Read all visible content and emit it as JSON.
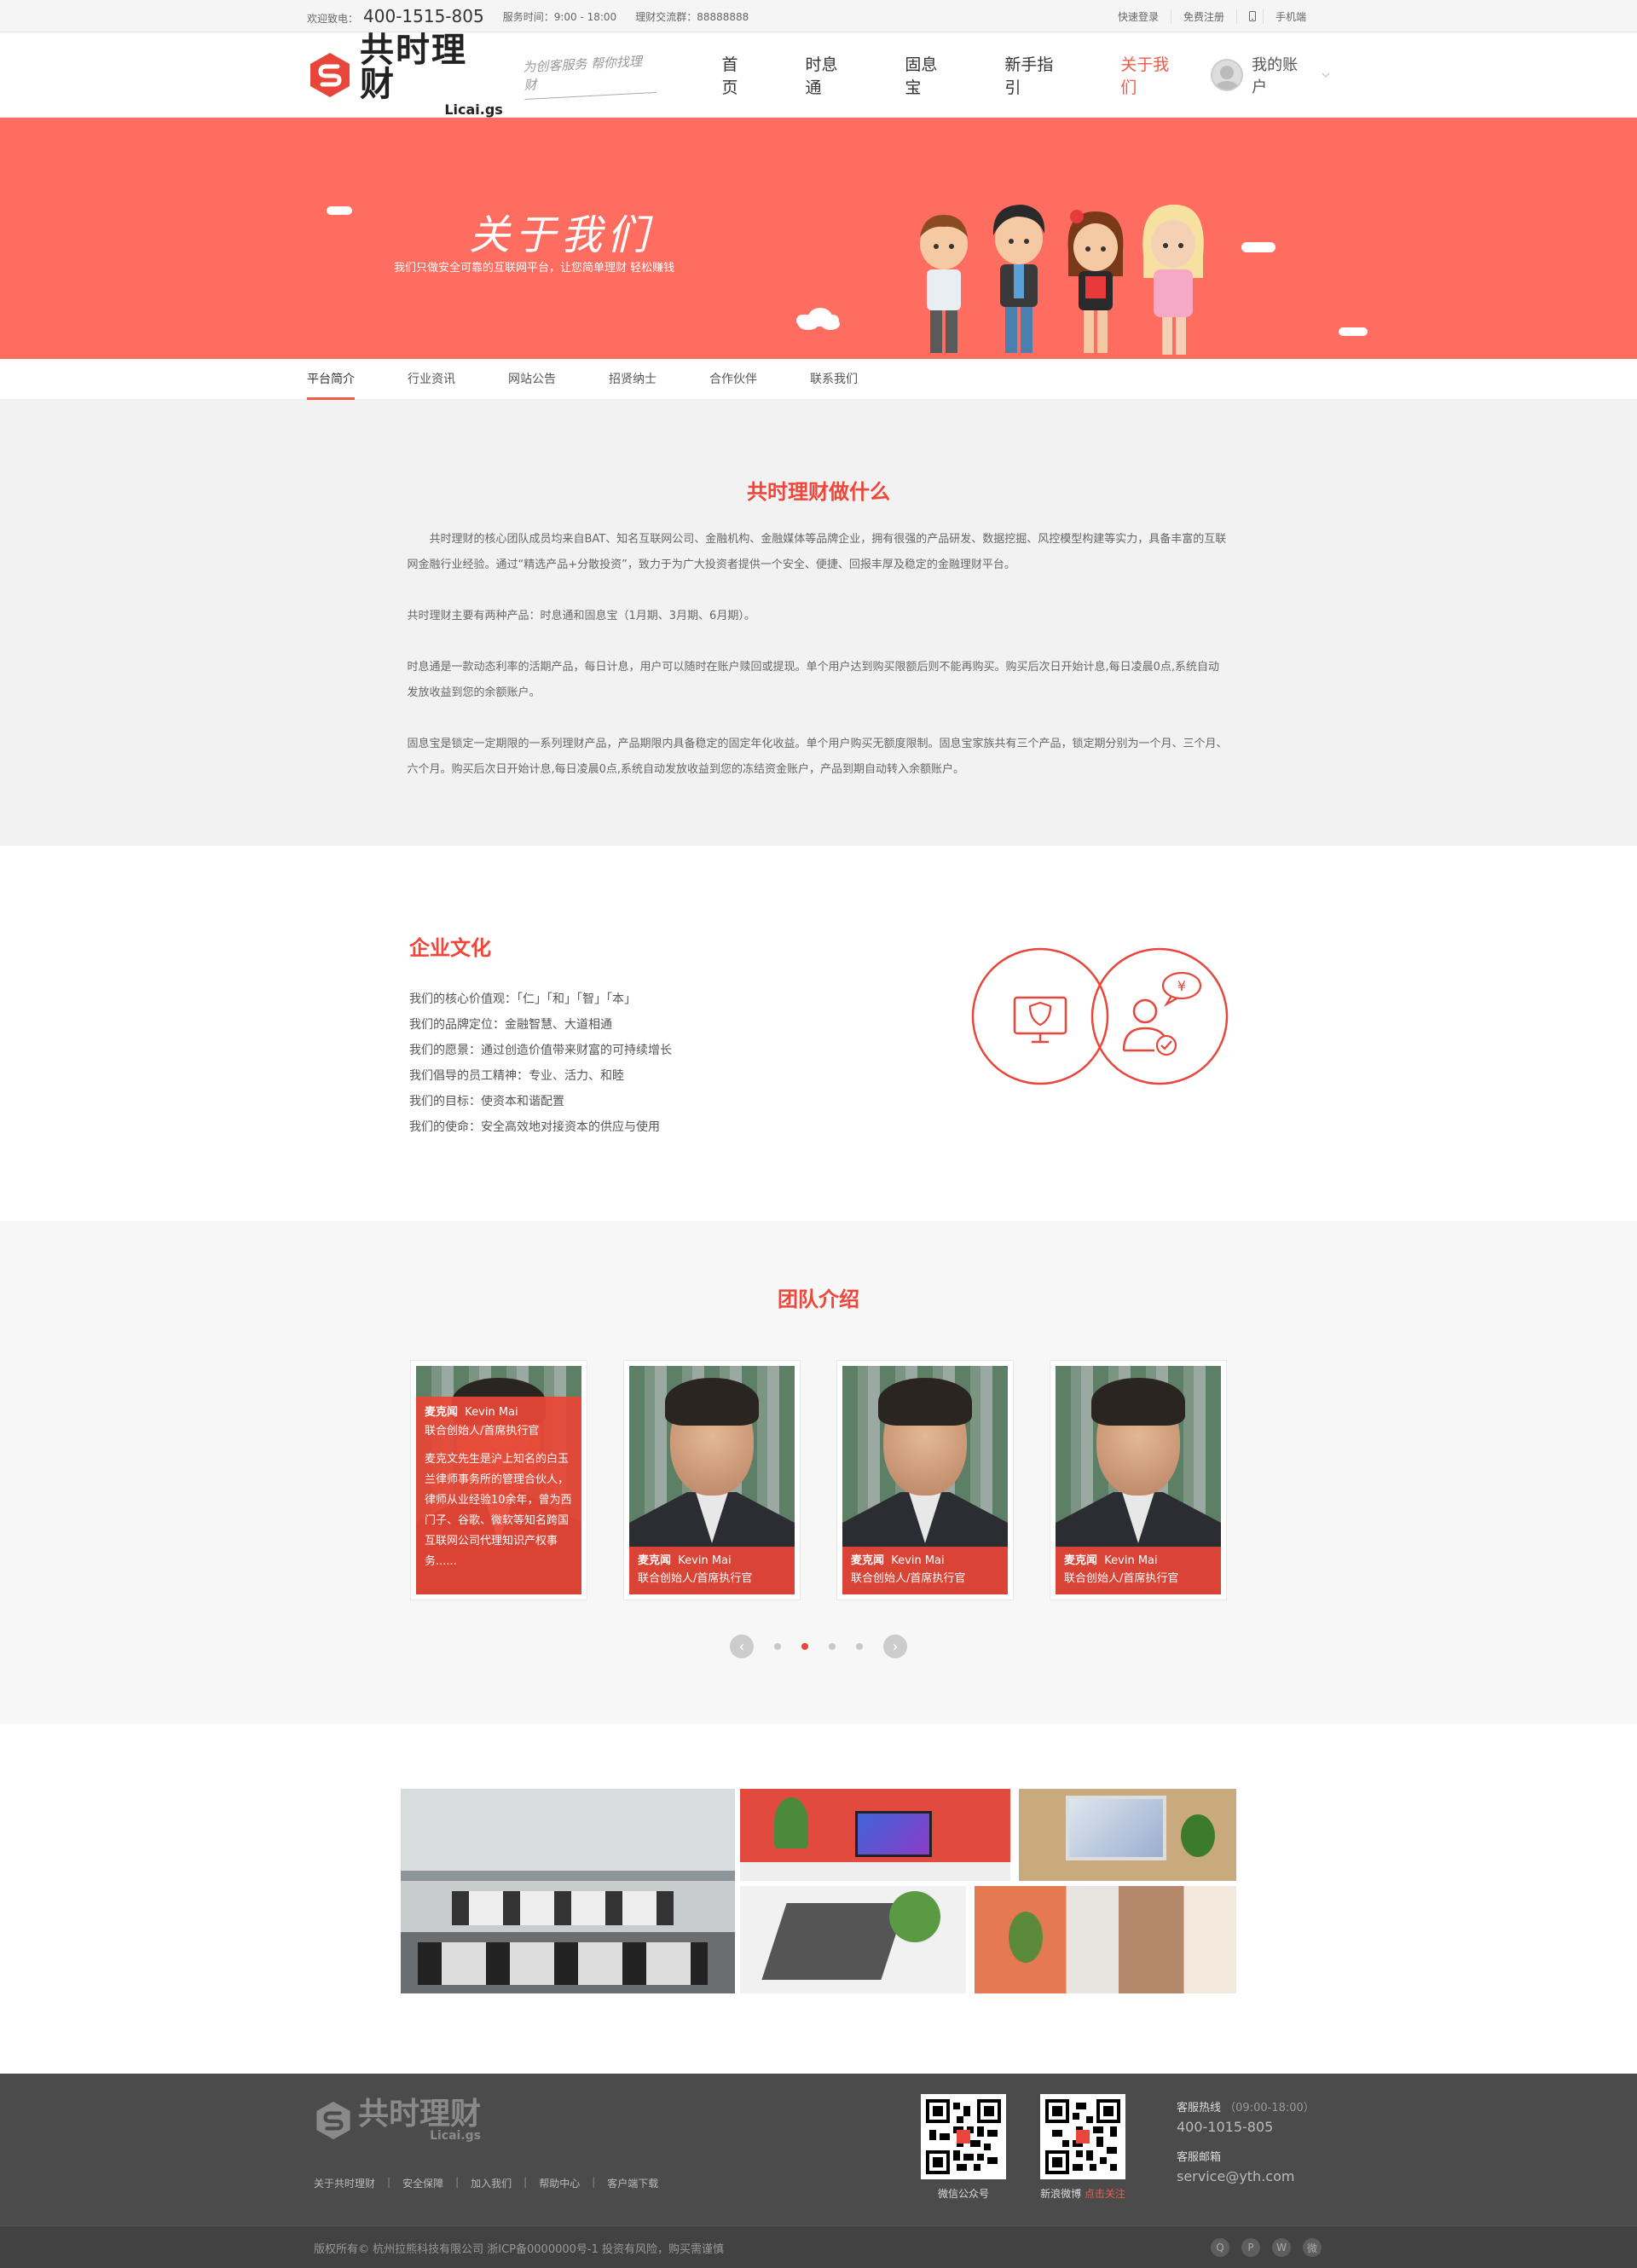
{
  "topbar": {
    "welcome": "欢迎致电：",
    "phone": "400-1515-805",
    "service_hours": "服务时间：9:00 - 18:00",
    "group": "理财交流群：88888888",
    "quick_login": "快速登录",
    "register": "免费注册",
    "mobile": "手机端"
  },
  "header": {
    "logo_cn": "共时理财",
    "logo_en": "Licai.gs",
    "slogan": "为创客服务 帮你找理财",
    "nav": [
      "首页",
      "时息通",
      "固息宝",
      "新手指引",
      "关于我们"
    ],
    "account": "我的账户"
  },
  "banner": {
    "title": "关于我们",
    "subtitle": "我们只做安全可靠的互联网平台，让您简单理财 轻松赚钱"
  },
  "subnav": [
    "平台简介",
    "行业资讯",
    "网站公告",
    "招贤纳士",
    "合作伙伴",
    "联系我们"
  ],
  "intro": {
    "title": "共时理财做什么",
    "paragraphs": [
      "共时理财的核心团队成员均来自BAT、知名互联网公司、金融机构、金融媒体等品牌企业，拥有很强的产品研发、数据挖掘、风控模型构建等实力，具备丰富的互联网金融行业经验。通过“精选产品+分散投资”，致力于为广大投资者提供一个安全、便捷、回报丰厚及稳定的金融理财平台。",
      "共时理财主要有两种产品：时息通和固息宝（1月期、3月期、6月期）。",
      "时息通是一款动态利率的活期产品，每日计息，用户可以随时在账户赎回或提现。单个用户达到购买限额后则不能再购买。购买后次日开始计息,每日凌晨0点,系统自动发放收益到您的余额账户。",
      "固息宝是锁定一定期限的一系列理财产品，产品期限内具备稳定的固定年化收益。单个用户购买无额度限制。固息宝家族共有三个产品，锁定期分别为一个月、三个月、六个月。购买后次日开始计息,每日凌晨0点,系统自动发放收益到您的冻结资金账户，产品到期自动转入余额账户。"
    ]
  },
  "culture": {
    "title": "企业文化",
    "items": [
      "我们的核心价值观：「仁」「和」「智」「本」",
      "我们的品牌定位：金融智慧、大道相通",
      "我们的愿景：通过创造价值带来财富的可持续增长",
      "我们倡导的员工精神：专业、活力、和睦",
      "我们的目标：使资本和谐配置",
      "我们的使命：安全高效地对接资本的供应与使用"
    ],
    "currency_symbol": "¥"
  },
  "team": {
    "title": "团队介绍",
    "members": [
      {
        "name": "麦克闻",
        "en": "Kevin Mai",
        "role": "联合创始人/首席执行官",
        "bio": "麦克文先生是沪上知名的白玉兰律师事务所的管理合伙人，律师从业经验10余年，曾为西门子、谷歌、微软等知名跨国互联网公司代理知识产权事务......"
      },
      {
        "name": "麦克闻",
        "en": "Kevin Mai",
        "role": "联合创始人/首席执行官"
      },
      {
        "name": "麦克闻",
        "en": "Kevin Mai",
        "role": "联合创始人/首席执行官"
      },
      {
        "name": "麦克闻",
        "en": "Kevin Mai",
        "role": "联合创始人/首席执行官"
      }
    ],
    "prev": "‹",
    "next": "›"
  },
  "footer": {
    "logo_cn": "共时理财",
    "logo_en": "Licai.gs",
    "links": [
      "关于共时理财",
      "安全保障",
      "加入我们",
      "帮助中心",
      "客户端下载"
    ],
    "qr1_label": "微信公众号",
    "qr2_label": "新浪微博",
    "qr2_follow": "点击关注",
    "hotline_label": "客服热线",
    "hotline_hours": "（09:00-18:00）",
    "hotline": "400-1015-805",
    "email_label": "客服邮箱",
    "email": "service@yth.com",
    "copyright": "版权所有© 杭州拉熊科技有限公司  浙ICP备0000000号-1  投资有风险，购买需谨慎"
  },
  "colors": {
    "brand": "#f25a4a",
    "banner": "#ff6c60",
    "footer": "#4b4b4b"
  }
}
